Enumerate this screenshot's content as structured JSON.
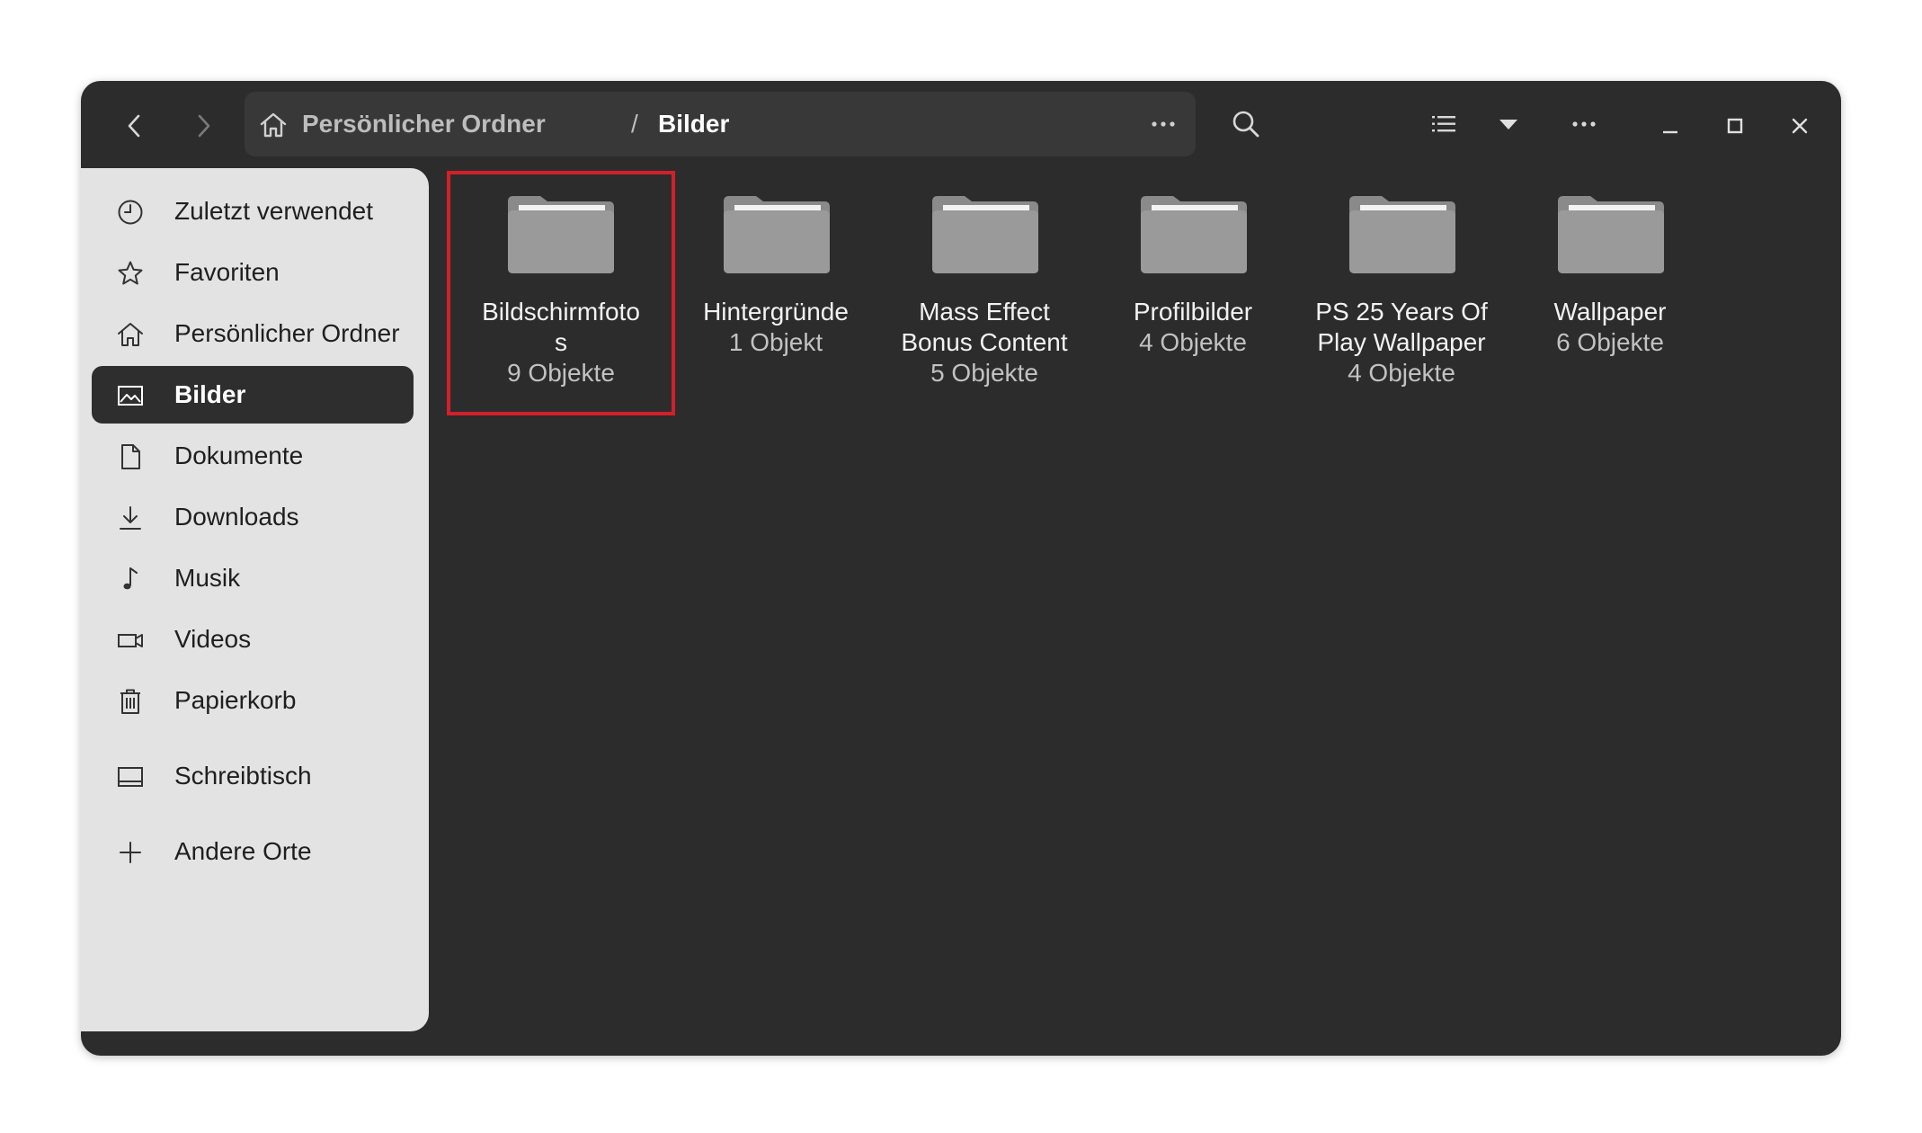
{
  "window": {
    "background": "#2c2c2c",
    "sidebar_background": "#e3e3e3",
    "selection_box_color": "#d2202a"
  },
  "header": {
    "back_icon": "chevron-left-icon",
    "forward_icon": "chevron-right-icon",
    "breadcrumb": {
      "home_icon": "home-icon",
      "items": [
        "Persönlicher Ordner",
        "Bilder"
      ],
      "separator": "/"
    },
    "path_menu_icon": "ellipsis-icon",
    "search_icon": "search-icon",
    "view_list_icon": "list-view-icon",
    "view_options_icon": "caret-down-icon",
    "main_menu_icon": "ellipsis-icon",
    "minimize_icon": "minimize-icon",
    "maximize_icon": "maximize-icon",
    "close_icon": "close-icon"
  },
  "sidebar": {
    "items": [
      {
        "label": "Zuletzt verwendet",
        "icon": "clock-icon"
      },
      {
        "label": "Favoriten",
        "icon": "star-icon"
      },
      {
        "label": "Persönlicher Ordner",
        "icon": "home-icon"
      },
      {
        "label": "Bilder",
        "icon": "image-icon",
        "active": true
      },
      {
        "label": "Dokumente",
        "icon": "document-icon"
      },
      {
        "label": "Downloads",
        "icon": "download-icon"
      },
      {
        "label": "Musik",
        "icon": "music-icon"
      },
      {
        "label": "Videos",
        "icon": "video-icon"
      },
      {
        "label": "Papierkorb",
        "icon": "trash-icon"
      },
      {
        "label": "Schreibtisch",
        "icon": "desktop-icon"
      },
      {
        "label": "Andere Orte",
        "icon": "plus-icon"
      }
    ]
  },
  "folders": [
    {
      "name_line1": "Bildschirmfoto",
      "name_line2": "s",
      "count": "9 Objekte",
      "selected": true
    },
    {
      "name_line1": "Hintergründe",
      "name_line2": "",
      "count": "1 Objekt"
    },
    {
      "name_line1": "Mass Effect",
      "name_line2": "Bonus Content",
      "count": "5 Objekte"
    },
    {
      "name_line1": "Profilbilder",
      "name_line2": "",
      "count": "4 Objekte"
    },
    {
      "name_line1": "PS 25 Years Of",
      "name_line2": "Play Wallpaper",
      "count": "4 Objekte"
    },
    {
      "name_line1": "Wallpaper",
      "name_line2": "",
      "count": "6 Objekte"
    }
  ]
}
